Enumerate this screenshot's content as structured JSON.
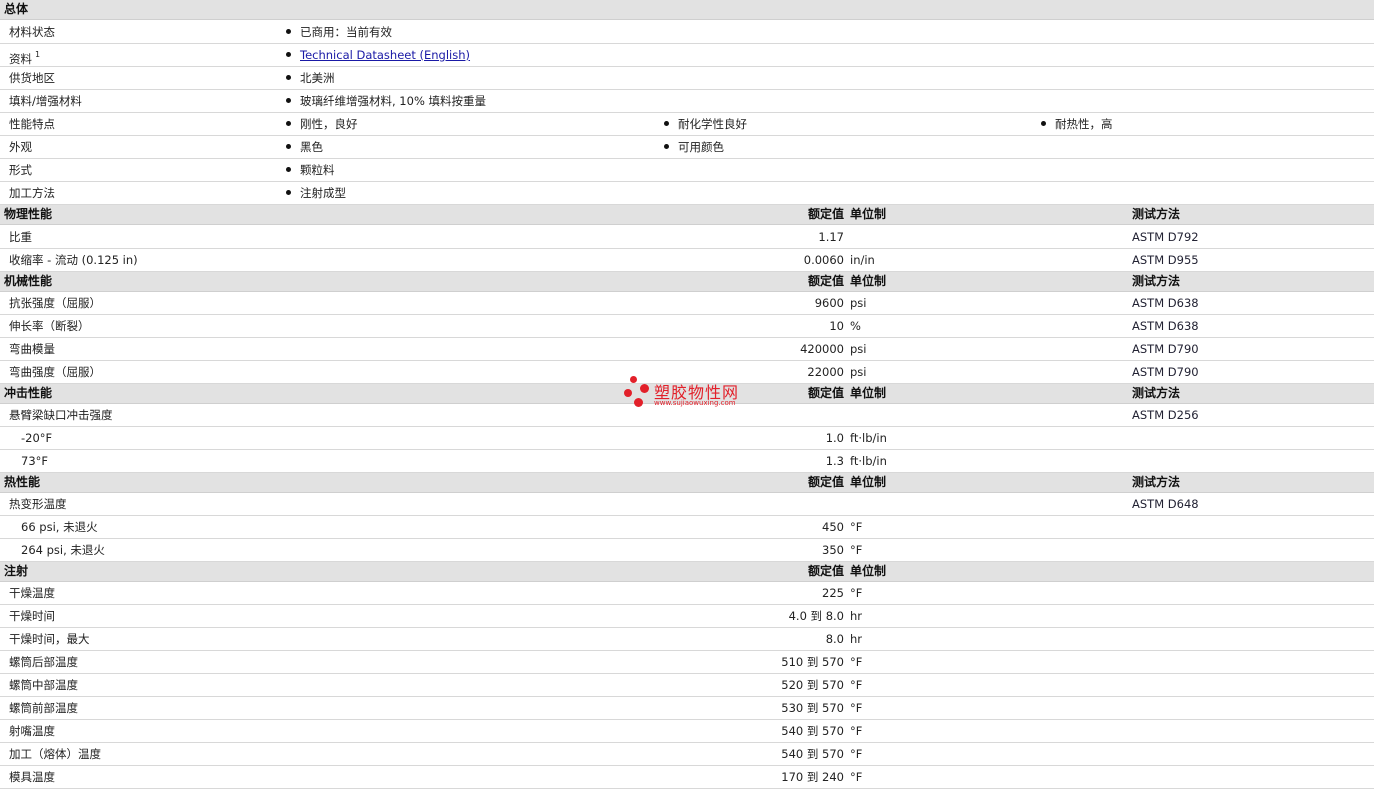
{
  "general": {
    "header": "总体",
    "status": {
      "label": "材料状态",
      "value": "已商用：当前有效"
    },
    "docs": {
      "label": "资料",
      "sup": "1",
      "link": "Technical Datasheet (English)"
    },
    "region": {
      "label": "供货地区",
      "value": "北美洲"
    },
    "filler": {
      "label": "填料/增强材料",
      "value": "玻璃纤维增强材料, 10% 填料按重量"
    },
    "features": {
      "label": "性能特点",
      "v1": "刚性，良好",
      "v2": "耐化学性良好",
      "v3": "耐热性，高"
    },
    "appearance": {
      "label": "外观",
      "v1": "黑色",
      "v2": "可用颜色"
    },
    "form": {
      "label": "形式",
      "value": "颗粒料"
    },
    "processing": {
      "label": "加工方法",
      "value": "注射成型"
    }
  },
  "col_headers": {
    "rated": "额定值",
    "unit": "单位制",
    "test": "测试方法"
  },
  "physical": {
    "header": "物理性能",
    "rows": [
      {
        "label": "比重",
        "value": "1.17",
        "unit": "",
        "test": "ASTM D792"
      },
      {
        "label": "收缩率  - 流动   (0.125 in)",
        "value": "0.0060",
        "unit": "in/in",
        "test": "ASTM D955"
      }
    ]
  },
  "mechanical": {
    "header": "机械性能",
    "rows": [
      {
        "label": "抗张强度（屈服）",
        "value": "9600",
        "unit": "psi",
        "test": "ASTM D638"
      },
      {
        "label": "伸长率（断裂）",
        "value": "10",
        "unit": "%",
        "test": "ASTM D638"
      },
      {
        "label": "弯曲模量",
        "value": "420000",
        "unit": "psi",
        "test": "ASTM D790"
      },
      {
        "label": "弯曲强度（屈服）",
        "value": "22000",
        "unit": "psi",
        "test": "ASTM D790"
      }
    ]
  },
  "impact": {
    "header": "冲击性能",
    "main": {
      "label": "悬臂梁缺口冲击强度",
      "test": "ASTM D256"
    },
    "rows": [
      {
        "label": "-20°F",
        "value": "1.0",
        "unit": "ft·lb/in"
      },
      {
        "label": "73°F",
        "value": "1.3",
        "unit": "ft·lb/in"
      }
    ]
  },
  "thermal": {
    "header": "热性能",
    "main": {
      "label": "热变形温度",
      "test": "ASTM D648"
    },
    "rows": [
      {
        "label": "66 psi, 未退火",
        "value": "450",
        "unit": "°F"
      },
      {
        "label": "264 psi, 未退火",
        "value": "350",
        "unit": "°F"
      }
    ]
  },
  "injection": {
    "header": "注射",
    "rows": [
      {
        "label": "干燥温度",
        "value": "225",
        "unit": "°F"
      },
      {
        "label": "干燥时间",
        "value": "4.0 到  8.0",
        "unit": "hr"
      },
      {
        "label": "干燥时间，最大",
        "value": "8.0",
        "unit": "hr"
      },
      {
        "label": "螺筒后部温度",
        "value": "510 到  570",
        "unit": "°F"
      },
      {
        "label": "螺筒中部温度",
        "value": "520 到  570",
        "unit": "°F"
      },
      {
        "label": "螺筒前部温度",
        "value": "530 到  570",
        "unit": "°F"
      },
      {
        "label": "射嘴温度",
        "value": "540 到  570",
        "unit": "°F"
      },
      {
        "label": "加工（熔体）温度",
        "value": "540 到  570",
        "unit": "°F"
      },
      {
        "label": "模具温度",
        "value": "170 到  240",
        "unit": "°F"
      }
    ]
  },
  "watermark": {
    "cn": "塑胶物性网",
    "url": "www.sujiaowuxing.com"
  }
}
